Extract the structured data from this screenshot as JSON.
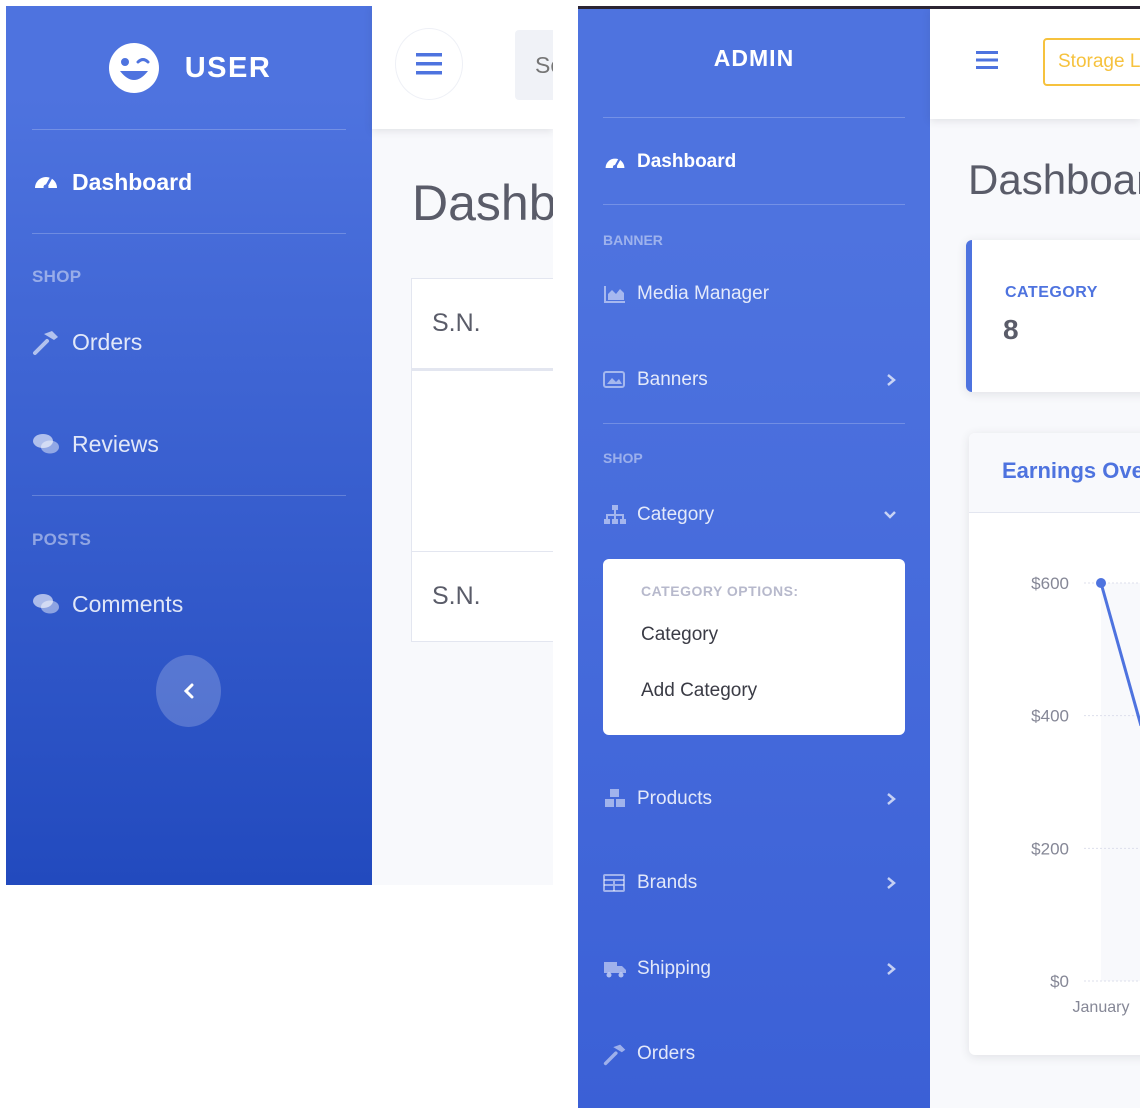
{
  "user_app": {
    "brand": "USER",
    "nav": {
      "dashboard": "Dashboard",
      "shop_heading": "SHOP",
      "orders": "Orders",
      "reviews": "Reviews",
      "posts_heading": "POSTS",
      "comments": "Comments"
    },
    "topbar": {
      "search_placeholder": "Search for..."
    },
    "page_title": "Dashboard",
    "table": {
      "header": "S.N.",
      "footer": "S.N."
    }
  },
  "admin_app": {
    "brand": "ADMIN",
    "nav": {
      "dashboard": "Dashboard",
      "banner_heading": "BANNER",
      "media_manager": "Media Manager",
      "banners": "Banners",
      "shop_heading": "SHOP",
      "category": "Category",
      "category_submenu": {
        "heading": "CATEGORY OPTIONS:",
        "items": [
          "Category",
          "Add Category"
        ]
      },
      "products": "Products",
      "brands": "Brands",
      "shipping": "Shipping",
      "orders": "Orders"
    },
    "topbar": {
      "storage_button": "Storage Link"
    },
    "page_title": "Dashboard",
    "category_card": {
      "label": "CATEGORY",
      "value": "8"
    },
    "earnings_card": {
      "title": "Earnings Overview"
    }
  },
  "colors": {
    "primary": "#4e73df",
    "primary_dark": "#224abe",
    "warning": "#f6c23e",
    "text": "#5a5c69"
  },
  "chart_data": {
    "type": "line",
    "title": "Earnings Overview",
    "x": [
      "January"
    ],
    "series": [
      {
        "values": [
          600
        ]
      }
    ],
    "yticks": [
      "$600",
      "$400",
      "$200",
      "$0"
    ],
    "ylim": [
      0,
      600
    ],
    "grid": true
  }
}
